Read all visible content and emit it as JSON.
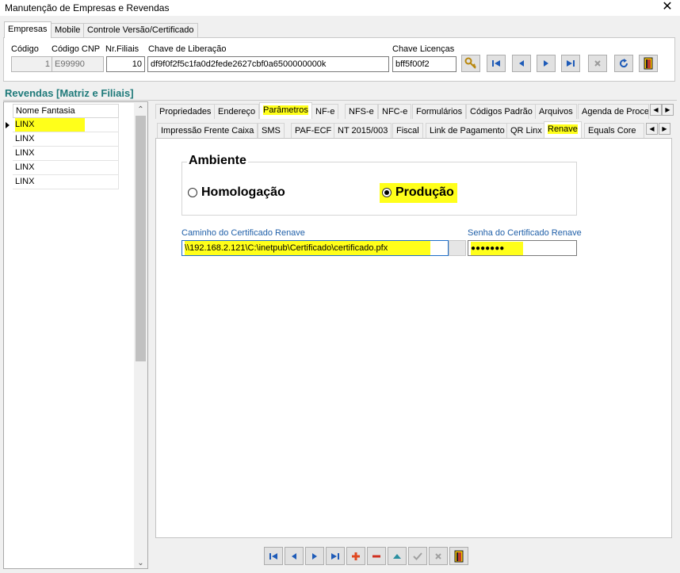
{
  "window": {
    "title": "Manutenção de Empresas e Revendas",
    "close_icon": "close-icon"
  },
  "top_tabs": [
    {
      "label": "Empresas",
      "active": true
    },
    {
      "label": "Mobile",
      "active": false
    },
    {
      "label": "Controle Versão/Certificado",
      "active": false
    }
  ],
  "empresa": {
    "codigo_label": "Código",
    "codigo_value": "1",
    "codigo_cnp_label": "Código CNP",
    "codigo_cnp_value": "E99990",
    "nr_filiais_label": "Nr.Filiais",
    "nr_filiais_value": "10",
    "chave_liberacao_label": "Chave de Liberação",
    "chave_liberacao_value": "df9f0f2f5c1fa0d2fede2627cbf0a6500000000k",
    "chave_licencas_label": "Chave Licenças",
    "chave_licencas_value": "bff5f00f2"
  },
  "revendas": {
    "title": "Revendas [Matriz e Filiais]",
    "column": "Nome Fantasia",
    "rows": [
      "LINX",
      "LINX",
      "LINX",
      "LINX",
      "LINX"
    ]
  },
  "tabs_row1": [
    "Propriedades",
    "Endereço",
    "Parâmetros",
    "NF-e",
    "NFS-e",
    "NFC-e",
    "Formulários",
    "Códigos Padrão",
    "Arquivos",
    "Agenda de Proces"
  ],
  "tabs_row2": [
    "Impressão Frente Caixa",
    "SMS",
    "PAF-ECF",
    "NT 2015/003",
    "Fiscal",
    "Link de Pagamento",
    "QR Linx",
    "Renave",
    "Equals Core"
  ],
  "renave": {
    "ambiente_title": "Ambiente",
    "homologacao": "Homologação",
    "producao": "Produção",
    "selected": "Produção",
    "caminho_label": "Caminho do Certificado Renave",
    "caminho_value": "\\\\192.168.2.121\\C:\\inetpub\\Certificado\\certificado.pfx",
    "senha_label": "Senha do Certificado Renave",
    "senha_value": "●●●●●●●"
  },
  "colors": {
    "highlight": "#ffff1a",
    "section_title": "#1f7a7a",
    "field_label": "#1f5fa8"
  }
}
